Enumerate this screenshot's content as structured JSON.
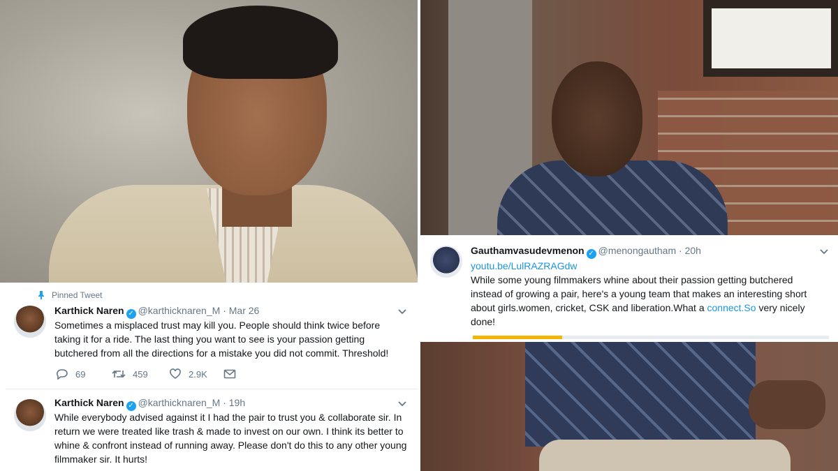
{
  "tweets": {
    "pinned": {
      "pinned_label": "Pinned Tweet",
      "name": "Karthick Naren",
      "handle": "@karthicknaren_M",
      "dot": "·",
      "time": "Mar 26",
      "text": "Sometimes a misplaced trust may kill you. People should think twice before taking it for a ride. The last thing you want to see is your passion getting butchered from all the directions for a mistake you did not commit. Threshold!",
      "replies": "69",
      "retweets": "459",
      "likes": "2.9K"
    },
    "reply": {
      "name": "Karthick Naren",
      "handle": "@karthicknaren_M",
      "dot": "·",
      "time": "19h",
      "text": "While everybody advised against it I had the pair to trust you & collaborate sir. In return we were treated like trash & made to invest on our own. I think its better to whine & confront instead of running away. Please don't do this to any other young filmmaker sir. It hurts!"
    },
    "gautham": {
      "name": "Gauthamvasudevmenon",
      "handle": "@menongautham",
      "dot": "·",
      "time": "20h",
      "link": "youtu.be/LulRAZRAGdw",
      "text_before": "While some young  filmmakers whine about their passion getting butchered instead of growing a pair, here's a young team that makes an interesting short about girls.women, cricket, CSK and liberation.What a ",
      "text_link": "connect.So",
      "text_after": " very nicely done!",
      "video_progress": 0.25
    }
  },
  "colors": {
    "link": "#1b95e0",
    "verified": "#1da1f2",
    "muted": "#657786",
    "progress": "#f4b400"
  },
  "icons": [
    "pin-icon",
    "verified-icon",
    "chevron-down-icon",
    "reply-icon",
    "retweet-icon",
    "like-icon",
    "direct-message-icon"
  ]
}
